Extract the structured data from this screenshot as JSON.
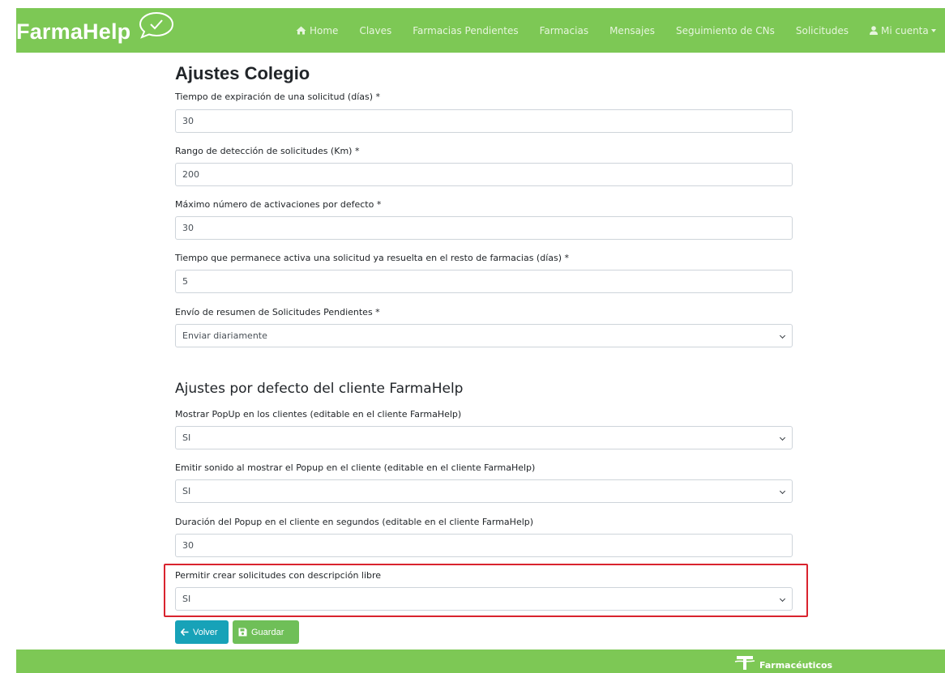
{
  "brand": {
    "name": "FarmaHelp"
  },
  "nav": {
    "items": [
      {
        "label": "Home",
        "icon": "home-icon"
      },
      {
        "label": "Claves"
      },
      {
        "label": "Farmacias Pendientes"
      },
      {
        "label": "Farmacias"
      },
      {
        "label": "Mensajes"
      },
      {
        "label": "Seguimiento de CNs"
      },
      {
        "label": "Solicitudes"
      },
      {
        "label": "Mi cuenta",
        "icon": "user-icon"
      }
    ]
  },
  "page": {
    "title": "Ajustes Colegio",
    "section2_title": "Ajustes por defecto del cliente FarmaHelp"
  },
  "fields": [
    {
      "label": "Tiempo de expiración de una solicitud (días) *",
      "value": "30"
    },
    {
      "label": "Rango de detección de solicitudes (Km) *",
      "value": "200"
    },
    {
      "label": "Máximo número de activaciones por defecto *",
      "value": "30"
    },
    {
      "label": "Tiempo que permanece activa una solicitud ya resuelta en el resto de farmacias (días) *",
      "value": "5"
    },
    {
      "label": "Envío de resumen de Solicitudes Pendientes *",
      "value": "Enviar diariamente"
    },
    {
      "label": "Mostrar PopUp en los clientes (editable en el cliente FarmaHelp)",
      "value": "SI"
    },
    {
      "label": "Emitir sonido al mostrar el Popup en el cliente (editable en el cliente FarmaHelp)",
      "value": "SI"
    },
    {
      "label": "Duración del Popup en el cliente en segundos (editable en el cliente FarmaHelp)",
      "value": "30"
    },
    {
      "label": "Permitir crear solicitudes con descripción libre",
      "value": "SI"
    }
  ],
  "buttons": {
    "back": "Volver",
    "save": "Guardar"
  },
  "footer": {
    "logo_text": "Farmacéuticos"
  },
  "colors": {
    "navbar": "#7dc855",
    "back_button": "#17a2b8",
    "save_button": "#6fbf58",
    "highlight": "#d9232e"
  }
}
